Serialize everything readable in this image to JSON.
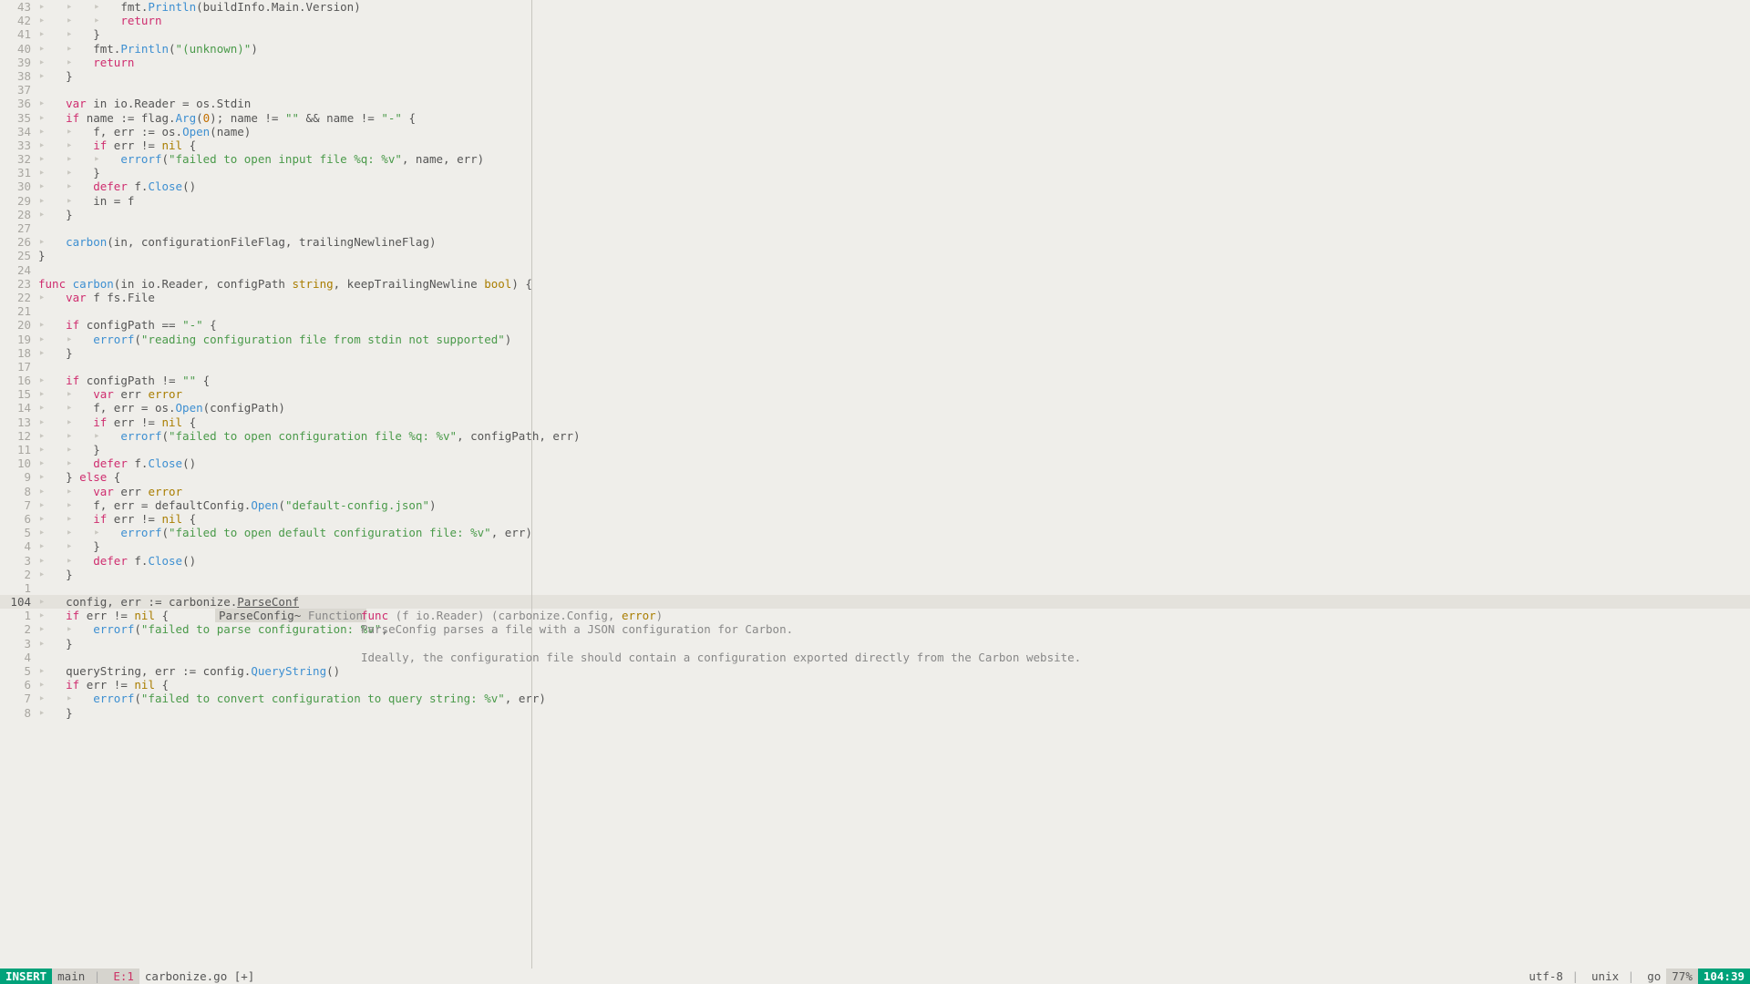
{
  "lines": [
    {
      "n": "43",
      "ws": "‣   ‣   ‣   ",
      "tokens": [
        [
          "id",
          "fmt"
        ],
        [
          "id",
          "."
        ],
        [
          "fn",
          "Println"
        ],
        [
          "id",
          "(buildInfo.Main.Version)"
        ]
      ]
    },
    {
      "n": "42",
      "ws": "‣   ‣   ‣   ",
      "tokens": [
        [
          "kw",
          "return"
        ]
      ]
    },
    {
      "n": "41",
      "ws": "‣   ‣   ",
      "tokens": [
        [
          "id",
          "}"
        ]
      ]
    },
    {
      "n": "40",
      "ws": "‣   ‣   ",
      "tokens": [
        [
          "id",
          "fmt."
        ],
        [
          "fn",
          "Println"
        ],
        [
          "id",
          "("
        ],
        [
          "str",
          "\"(unknown)\""
        ],
        [
          "id",
          ")"
        ]
      ]
    },
    {
      "n": "39",
      "ws": "‣   ‣   ",
      "tokens": [
        [
          "kw",
          "return"
        ]
      ]
    },
    {
      "n": "38",
      "ws": "‣   ",
      "tokens": [
        [
          "id",
          "}"
        ]
      ]
    },
    {
      "n": "37",
      "ws": "",
      "tokens": []
    },
    {
      "n": "36",
      "ws": "‣   ",
      "tokens": [
        [
          "kw",
          "var"
        ],
        [
          "id",
          " in io.Reader = os.Stdin"
        ]
      ]
    },
    {
      "n": "35",
      "ws": "‣   ",
      "tokens": [
        [
          "kw",
          "if"
        ],
        [
          "id",
          " name := flag."
        ],
        [
          "fn",
          "Arg"
        ],
        [
          "id",
          "("
        ],
        [
          "num",
          "0"
        ],
        [
          "id",
          "); name != "
        ],
        [
          "str",
          "\"\""
        ],
        [
          "id",
          " && name != "
        ],
        [
          "str",
          "\"-\""
        ],
        [
          "id",
          " {"
        ]
      ]
    },
    {
      "n": "34",
      "ws": "‣   ‣   ",
      "tokens": [
        [
          "id",
          "f, err := os."
        ],
        [
          "fn",
          "Open"
        ],
        [
          "id",
          "(name)"
        ]
      ]
    },
    {
      "n": "33",
      "ws": "‣   ‣   ",
      "tokens": [
        [
          "kw",
          "if"
        ],
        [
          "id",
          " err != "
        ],
        [
          "ty",
          "nil"
        ],
        [
          "id",
          " {"
        ]
      ]
    },
    {
      "n": "32",
      "ws": "‣   ‣   ‣   ",
      "tokens": [
        [
          "fn",
          "errorf"
        ],
        [
          "id",
          "("
        ],
        [
          "str",
          "\"failed to open input file %q: %v\""
        ],
        [
          "id",
          ", name, err)"
        ]
      ]
    },
    {
      "n": "31",
      "ws": "‣   ‣   ",
      "tokens": [
        [
          "id",
          "}"
        ]
      ]
    },
    {
      "n": "30",
      "ws": "‣   ‣   ",
      "tokens": [
        [
          "kw",
          "defer"
        ],
        [
          "id",
          " f."
        ],
        [
          "fn",
          "Close"
        ],
        [
          "id",
          "()"
        ]
      ]
    },
    {
      "n": "29",
      "ws": "‣   ‣   ",
      "tokens": [
        [
          "id",
          "in = f"
        ]
      ]
    },
    {
      "n": "28",
      "ws": "‣   ",
      "tokens": [
        [
          "id",
          "}"
        ]
      ]
    },
    {
      "n": "27",
      "ws": "",
      "tokens": []
    },
    {
      "n": "26",
      "ws": "‣   ",
      "tokens": [
        [
          "fn",
          "carbon"
        ],
        [
          "id",
          "(in, configurationFileFlag, trailingNewlineFlag)"
        ]
      ]
    },
    {
      "n": "25",
      "ws": "",
      "tokens": [
        [
          "id",
          "}"
        ]
      ]
    },
    {
      "n": "24",
      "ws": "",
      "tokens": []
    },
    {
      "n": "23",
      "ws": "",
      "tokens": [
        [
          "kw",
          "func"
        ],
        [
          "id",
          " "
        ],
        [
          "fn",
          "carbon"
        ],
        [
          "id",
          "(in io.Reader, configPath "
        ],
        [
          "ty",
          "string"
        ],
        [
          "id",
          ", keepTrailingNewline "
        ],
        [
          "ty",
          "bool"
        ],
        [
          "id",
          ") {"
        ]
      ]
    },
    {
      "n": "22",
      "ws": "‣   ",
      "tokens": [
        [
          "kw",
          "var"
        ],
        [
          "id",
          " f fs.File"
        ]
      ]
    },
    {
      "n": "21",
      "ws": "",
      "tokens": []
    },
    {
      "n": "20",
      "ws": "‣   ",
      "tokens": [
        [
          "kw",
          "if"
        ],
        [
          "id",
          " configPath == "
        ],
        [
          "str",
          "\"-\""
        ],
        [
          "id",
          " {"
        ]
      ]
    },
    {
      "n": "19",
      "ws": "‣   ‣   ",
      "tokens": [
        [
          "fn",
          "errorf"
        ],
        [
          "id",
          "("
        ],
        [
          "str",
          "\"reading configuration file from stdin not supported\""
        ],
        [
          "id",
          ")"
        ]
      ]
    },
    {
      "n": "18",
      "ws": "‣   ",
      "tokens": [
        [
          "id",
          "}"
        ]
      ]
    },
    {
      "n": "17",
      "ws": "",
      "tokens": []
    },
    {
      "n": "16",
      "ws": "‣   ",
      "tokens": [
        [
          "kw",
          "if"
        ],
        [
          "id",
          " configPath != "
        ],
        [
          "str",
          "\"\""
        ],
        [
          "id",
          " {"
        ]
      ]
    },
    {
      "n": "15",
      "ws": "‣   ‣   ",
      "tokens": [
        [
          "kw",
          "var"
        ],
        [
          "id",
          " err "
        ],
        [
          "ty",
          "error"
        ]
      ]
    },
    {
      "n": "14",
      "ws": "‣   ‣   ",
      "tokens": [
        [
          "id",
          "f, err = os."
        ],
        [
          "fn",
          "Open"
        ],
        [
          "id",
          "(configPath)"
        ]
      ]
    },
    {
      "n": "13",
      "ws": "‣   ‣   ",
      "tokens": [
        [
          "kw",
          "if"
        ],
        [
          "id",
          " err != "
        ],
        [
          "ty",
          "nil"
        ],
        [
          "id",
          " {"
        ]
      ]
    },
    {
      "n": "12",
      "ws": "‣   ‣   ‣   ",
      "tokens": [
        [
          "fn",
          "errorf"
        ],
        [
          "id",
          "("
        ],
        [
          "str",
          "\"failed to open configuration file %q: %v\""
        ],
        [
          "id",
          ", configPath, err)"
        ]
      ]
    },
    {
      "n": "11",
      "ws": "‣   ‣   ",
      "tokens": [
        [
          "id",
          "}"
        ]
      ]
    },
    {
      "n": "10",
      "ws": "‣   ‣   ",
      "tokens": [
        [
          "kw",
          "defer"
        ],
        [
          "id",
          " f."
        ],
        [
          "fn",
          "Close"
        ],
        [
          "id",
          "()"
        ]
      ]
    },
    {
      "n": "9",
      "ws": "‣   ",
      "tokens": [
        [
          "id",
          "} "
        ],
        [
          "kw",
          "else"
        ],
        [
          "id",
          " {"
        ]
      ]
    },
    {
      "n": "8",
      "ws": "‣   ‣   ",
      "tokens": [
        [
          "kw",
          "var"
        ],
        [
          "id",
          " err "
        ],
        [
          "ty",
          "error"
        ]
      ]
    },
    {
      "n": "7",
      "ws": "‣   ‣   ",
      "tokens": [
        [
          "id",
          "f, err = defaultConfig."
        ],
        [
          "fn",
          "Open"
        ],
        [
          "id",
          "("
        ],
        [
          "str",
          "\"default-config.json\""
        ],
        [
          "id",
          ")"
        ]
      ]
    },
    {
      "n": "6",
      "ws": "‣   ‣   ",
      "tokens": [
        [
          "kw",
          "if"
        ],
        [
          "id",
          " err != "
        ],
        [
          "ty",
          "nil"
        ],
        [
          "id",
          " {"
        ]
      ]
    },
    {
      "n": "5",
      "ws": "‣   ‣   ‣   ",
      "tokens": [
        [
          "fn",
          "errorf"
        ],
        [
          "id",
          "("
        ],
        [
          "str",
          "\"failed to open default configuration file: %v\""
        ],
        [
          "id",
          ", err)"
        ]
      ]
    },
    {
      "n": "4",
      "ws": "‣   ‣   ",
      "tokens": [
        [
          "id",
          "}"
        ]
      ]
    },
    {
      "n": "3",
      "ws": "‣   ‣   ",
      "tokens": [
        [
          "kw",
          "defer"
        ],
        [
          "id",
          " f."
        ],
        [
          "fn",
          "Close"
        ],
        [
          "id",
          "()"
        ]
      ]
    },
    {
      "n": "2",
      "ws": "‣   ",
      "tokens": [
        [
          "id",
          "}"
        ]
      ]
    },
    {
      "n": "1",
      "ws": "",
      "tokens": []
    },
    {
      "n": "104",
      "cur": true,
      "ws": "‣   ",
      "tokens": [
        [
          "id",
          "config, err := carbonize."
        ],
        [
          "id",
          "ParseConf"
        ]
      ],
      "underline_last": true
    },
    {
      "n": "1",
      "ws": "‣   ",
      "tokens": [
        [
          "kw",
          "if"
        ],
        [
          "id",
          " err != "
        ],
        [
          "ty",
          "nil"
        ],
        [
          "id",
          " {"
        ]
      ]
    },
    {
      "n": "2",
      "ws": "‣   ‣   ",
      "tokens": [
        [
          "fn",
          "errorf"
        ],
        [
          "id",
          "("
        ],
        [
          "str",
          "\"failed to parse configuration: %v\""
        ],
        [
          "id",
          ", ParseConfig parses a file with a JSON configuration for Carbon."
        ]
      ],
      "doc_overlay": true
    },
    {
      "n": "3",
      "ws": "‣   ",
      "tokens": [
        [
          "id",
          "}"
        ]
      ]
    },
    {
      "n": "4",
      "ws": "",
      "tokens": []
    },
    {
      "n": "5",
      "ws": "‣   ",
      "tokens": [
        [
          "id",
          "queryString, err := config."
        ],
        [
          "fn",
          "QueryString"
        ],
        [
          "id",
          "()"
        ]
      ]
    },
    {
      "n": "6",
      "ws": "‣   ",
      "tokens": [
        [
          "kw",
          "if"
        ],
        [
          "id",
          " err != "
        ],
        [
          "ty",
          "nil"
        ],
        [
          "id",
          " {"
        ]
      ]
    },
    {
      "n": "7",
      "ws": "‣   ‣   ",
      "tokens": [
        [
          "fn",
          "errorf"
        ],
        [
          "id",
          "("
        ],
        [
          "str",
          "\"failed to convert configuration to query string: %v\""
        ],
        [
          "id",
          ", err)"
        ]
      ]
    },
    {
      "n": "8",
      "ws": "‣   ",
      "tokens": [
        [
          "id",
          "}"
        ]
      ]
    }
  ],
  "completion": {
    "item": "ParseConfig~",
    "kind": "Function",
    "sig_pre": "func",
    "sig_mid": "(f io.Reader) (carbonize.Config, ",
    "sig_err": "error",
    "sig_post": ")",
    "doc1": "ParseConfig parses a file with a JSON configuration for Carbon.",
    "doc2": "Ideally, the configuration file should contain a configuration exported directly from the Carbon website."
  },
  "status": {
    "mode": "INSERT",
    "branch": "main",
    "errs": "E:1",
    "file": "carbonize.go [+]",
    "enc": "utf-8",
    "ff": "unix",
    "ft": "go",
    "pct": "77%",
    "pos": "104:39"
  }
}
